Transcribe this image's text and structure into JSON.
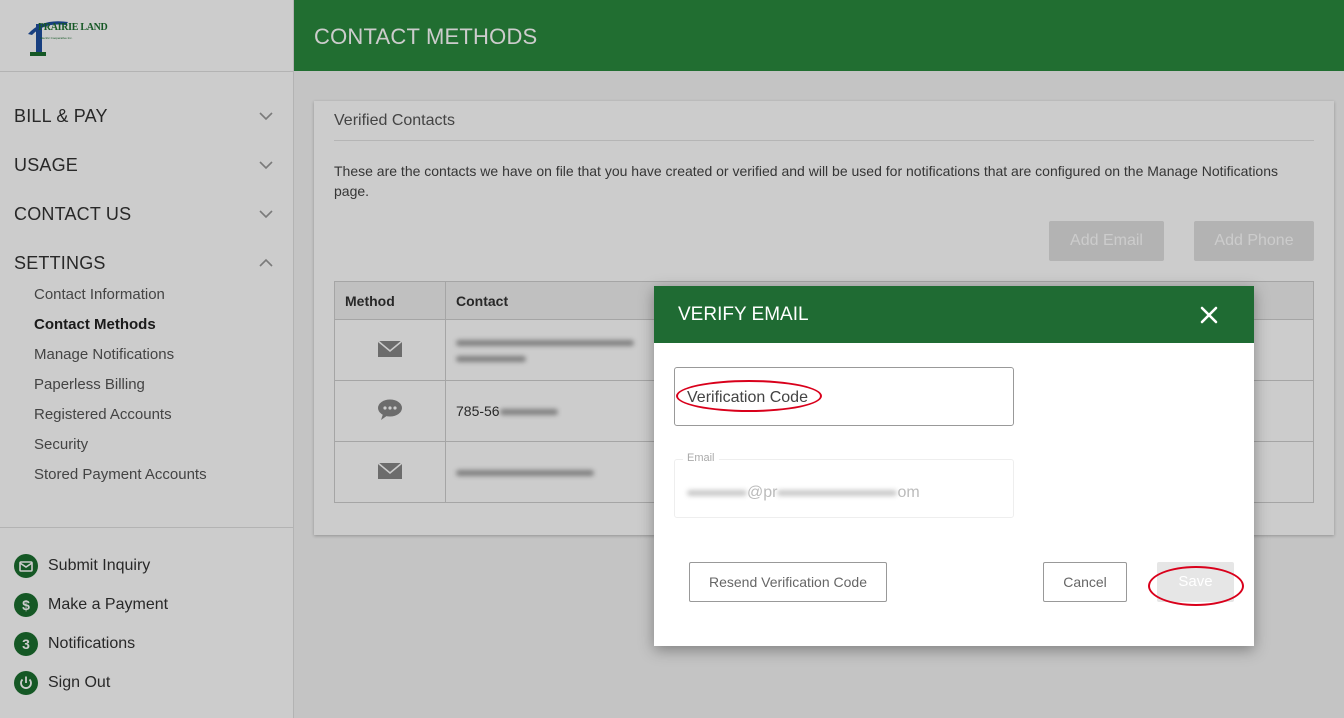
{
  "app": {
    "logo_text": "PRAIRIE LAND",
    "logo_subtext": "Electric Cooperative Inc.",
    "brand_color": "#2a8a3e"
  },
  "header": {
    "title": "CONTACT METHODS"
  },
  "sidebar": {
    "sections": [
      {
        "label": "BILL & PAY",
        "icon": "chevron-down-icon"
      },
      {
        "label": "USAGE",
        "icon": "chevron-down-icon"
      },
      {
        "label": "CONTACT US",
        "icon": "chevron-down-icon"
      },
      {
        "label": "SETTINGS",
        "icon": "chevron-up-icon"
      }
    ],
    "settings_items": [
      "Contact Information",
      "Contact Methods",
      "Manage Notifications",
      "Paperless Billing",
      "Registered Accounts",
      "Security",
      "Stored Payment Accounts"
    ],
    "active_item": "Contact Methods",
    "actions": [
      {
        "label": "Submit Inquiry",
        "icon": "envelope-icon"
      },
      {
        "label": "Make a Payment",
        "icon": "dollar-icon"
      },
      {
        "label": "Notifications",
        "icon": "notification-count-icon",
        "badge": "3"
      },
      {
        "label": "Sign Out",
        "icon": "power-icon"
      }
    ]
  },
  "card": {
    "title": "Verified Contacts",
    "description": "These are the contacts we have on file that you have created or verified and will be used for notifications that are configured on the Manage Notifications page.",
    "add_email_label": "Add Email",
    "add_phone_label": "Add Phone",
    "table": {
      "headers": [
        "Method",
        "Contact"
      ],
      "rows": [
        {
          "method_icon": "envelope-icon",
          "contact": ""
        },
        {
          "method_icon": "chat-bubble-icon",
          "contact": "785-56"
        },
        {
          "method_icon": "envelope-icon",
          "contact": ""
        }
      ]
    }
  },
  "modal": {
    "title": "VERIFY EMAIL",
    "verification_placeholder": "Verification Code",
    "email_label": "Email",
    "email_value_start": "",
    "email_value_mid": "@pr",
    "email_value_end": "om",
    "resend_label": "Resend Verification Code",
    "cancel_label": "Cancel",
    "save_label": "Save",
    "annotation_color": "#d9001b"
  }
}
